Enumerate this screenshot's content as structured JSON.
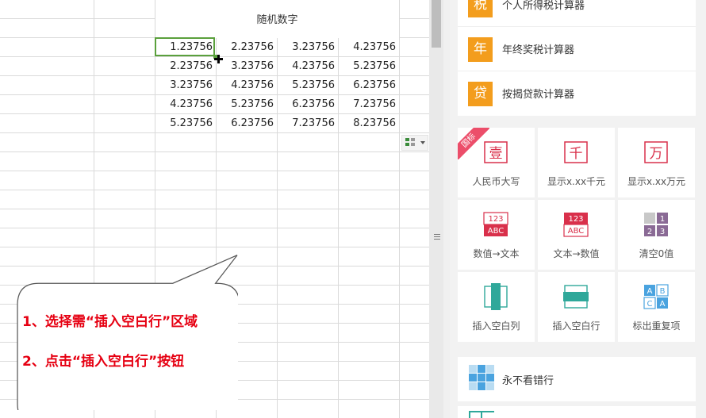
{
  "sheet": {
    "title": "随机数字",
    "rows": [
      [
        "1.23756",
        "2.23756",
        "3.23756",
        "4.23756"
      ],
      [
        "2.23756",
        "3.23756",
        "4.23756",
        "5.23756"
      ],
      [
        "3.23756",
        "4.23756",
        "5.23756",
        "6.23756"
      ],
      [
        "4.23756",
        "5.23756",
        "6.23756",
        "7.23756"
      ],
      [
        "5.23756",
        "6.23756",
        "7.23756",
        "8.23756"
      ]
    ],
    "selected_cell_color": "#5aa03c"
  },
  "callout": {
    "line1": "1、选择需“插入空白行”区域",
    "line2": "2、点击“插入空白行”按钮",
    "text_color": "#e60012"
  },
  "panel": {
    "top_list": [
      {
        "icon_text": "税",
        "label": "个人所得税计算器"
      },
      {
        "icon_text": "年",
        "label": "年终奖税计算器"
      },
      {
        "icon_text": "贷",
        "label": "按揭贷款计算器"
      }
    ],
    "ribbon": "国标",
    "tiles": [
      {
        "label": "人民币大写",
        "icon": "yi-capital-icon",
        "glyph": "壹"
      },
      {
        "label": "显示x.xx千元",
        "icon": "thousand-icon",
        "glyph": "千"
      },
      {
        "label": "显示x.xx万元",
        "icon": "ten-thousand-icon",
        "glyph": "万"
      },
      {
        "label": "数值→文本",
        "icon": "number-to-text-icon",
        "top": "123",
        "bottom": "ABC"
      },
      {
        "label": "文本→数值",
        "icon": "text-to-number-icon",
        "top": "123",
        "bottom": "ABC"
      },
      {
        "label": "清空0值",
        "icon": "clear-zero-icon",
        "digits": [
          "1",
          "2",
          "3"
        ]
      },
      {
        "label": "插入空白列",
        "icon": "insert-column-icon"
      },
      {
        "label": "插入空白行",
        "icon": "insert-row-icon"
      },
      {
        "label": "标出重复项",
        "icon": "mark-duplicates-icon",
        "letters": [
          "A",
          "B",
          "C",
          "A"
        ]
      }
    ],
    "bottom_list": [
      {
        "label": "永不看错行",
        "icon": "row-highlight-icon"
      }
    ],
    "colors": {
      "orange": "#f39d1d",
      "red": "#d9304b",
      "teal": "#2fa89a",
      "blue": "#4aa3df"
    }
  }
}
